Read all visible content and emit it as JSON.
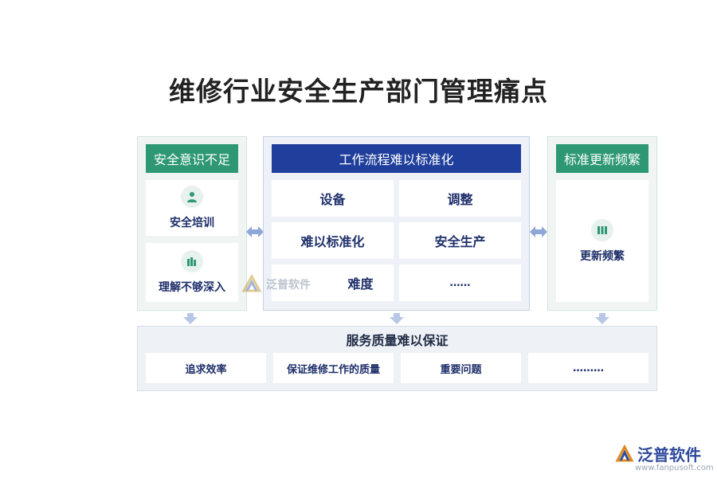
{
  "title": "维修行业安全生产部门管理痛点",
  "left_panel": {
    "header": "安全意识不足",
    "items": [
      {
        "label": "安全培训",
        "icon": "person-icon"
      },
      {
        "label": "理解不够深入",
        "icon": "books-icon"
      }
    ]
  },
  "center_panel": {
    "header": "工作流程难以标准化",
    "cells": [
      "设备",
      "调整",
      "难以标准化",
      "安全生产",
      "难度",
      "……"
    ]
  },
  "right_panel": {
    "header": "标准更新频繁",
    "items": [
      {
        "label": "更新频繁",
        "icon": "folders-icon"
      }
    ]
  },
  "bottom_panel": {
    "header": "服务质量难以保证",
    "cells": [
      "追求效率",
      "保证维修工作的质量",
      "重要问题",
      "………"
    ]
  },
  "watermark": {
    "text": "泛普软件"
  },
  "logo": {
    "name": "泛普软件",
    "url": "www.fanpusoft.com"
  },
  "colors": {
    "green": "#2e9874",
    "blue": "#203f9c",
    "text_blue": "#1e2f6a",
    "arrow": "#8ea6d8"
  }
}
